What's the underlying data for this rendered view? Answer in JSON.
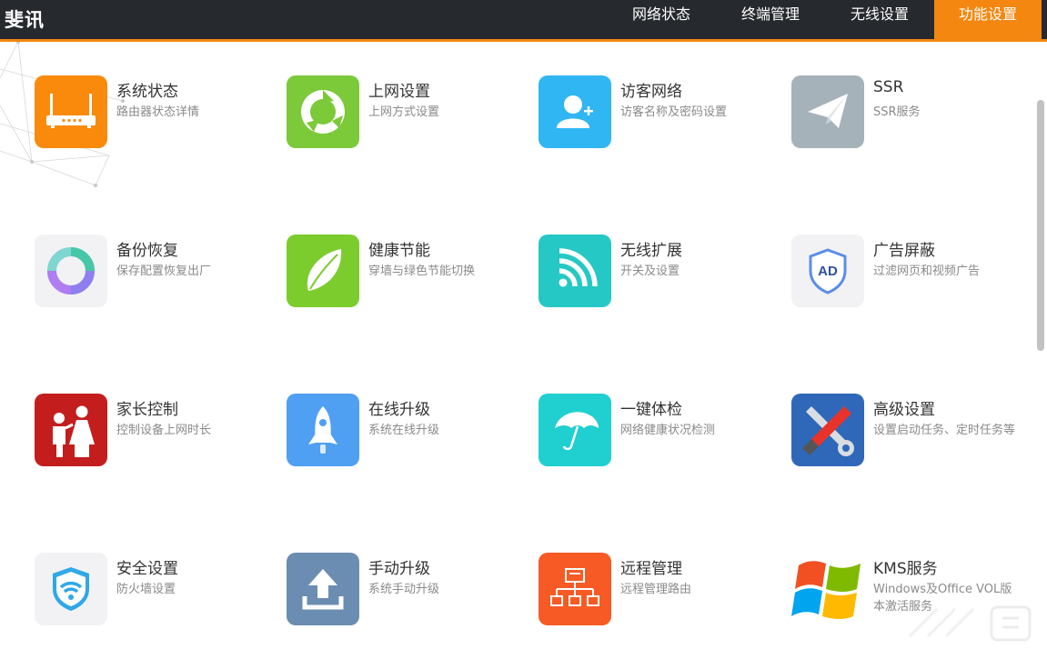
{
  "app": {
    "brand": "斐讯"
  },
  "nav": {
    "items": [
      {
        "label": "网络状态",
        "active": false
      },
      {
        "label": "终端管理",
        "active": false
      },
      {
        "label": "无线设置",
        "active": false
      },
      {
        "label": "功能设置",
        "active": true
      }
    ]
  },
  "colors": {
    "accent": "#f4870f",
    "topbar": "#26292e"
  },
  "tiles": [
    {
      "title": "系统状态",
      "desc": "路由器状态详情",
      "icon": "router-icon",
      "color": "#f98a0c"
    },
    {
      "title": "上网设置",
      "desc": "上网方式设置",
      "icon": "globe-ring-icon",
      "color": "#7cc93a"
    },
    {
      "title": "访客网络",
      "desc": "访客名称及密码设置",
      "icon": "add-user-icon",
      "color": "#30b6f2"
    },
    {
      "title": "SSR",
      "desc": "SSR服务",
      "icon": "paper-plane-icon",
      "color": "#a6b2ba"
    },
    {
      "title": "备份恢复",
      "desc": "保存配置恢复出厂",
      "icon": "backup-ring-icon",
      "color": "#f2f2f4"
    },
    {
      "title": "健康节能",
      "desc": "穿墙与绿色节能切换",
      "icon": "leaf-icon",
      "color": "#7ccc2e"
    },
    {
      "title": "无线扩展",
      "desc": "开关及设置",
      "icon": "wifi-signal-icon",
      "color": "#25c8c4"
    },
    {
      "title": "广告屏蔽",
      "desc": "过滤网页和视频广告",
      "icon": "ad-shield-icon",
      "color": "#f2f2f4"
    },
    {
      "title": "家长控制",
      "desc": "控制设备上网时长",
      "icon": "family-icon",
      "color": "#c41d1d"
    },
    {
      "title": "在线升级",
      "desc": "系统在线升级",
      "icon": "rocket-icon",
      "color": "#4f9ff2"
    },
    {
      "title": "一键体检",
      "desc": "网络健康状况检测",
      "icon": "umbrella-icon",
      "color": "#20cfcf"
    },
    {
      "title": "高级设置",
      "desc": "设置启动任务、定时任务等",
      "icon": "tools-icon",
      "color": "#2f68b8"
    },
    {
      "title": "安全设置",
      "desc": "防火墙设置",
      "icon": "wifi-shield-icon",
      "color": "#f2f2f4"
    },
    {
      "title": "手动升级",
      "desc": "系统手动升级",
      "icon": "upload-icon",
      "color": "#6b8db1"
    },
    {
      "title": "远程管理",
      "desc": "远程管理路由",
      "icon": "network-tree-icon",
      "color": "#f75a24"
    },
    {
      "title": "KMS服务",
      "desc": "Windows及Office VOL版本激活服务",
      "icon": "windows-logo-icon",
      "color": "#ffffff"
    }
  ]
}
